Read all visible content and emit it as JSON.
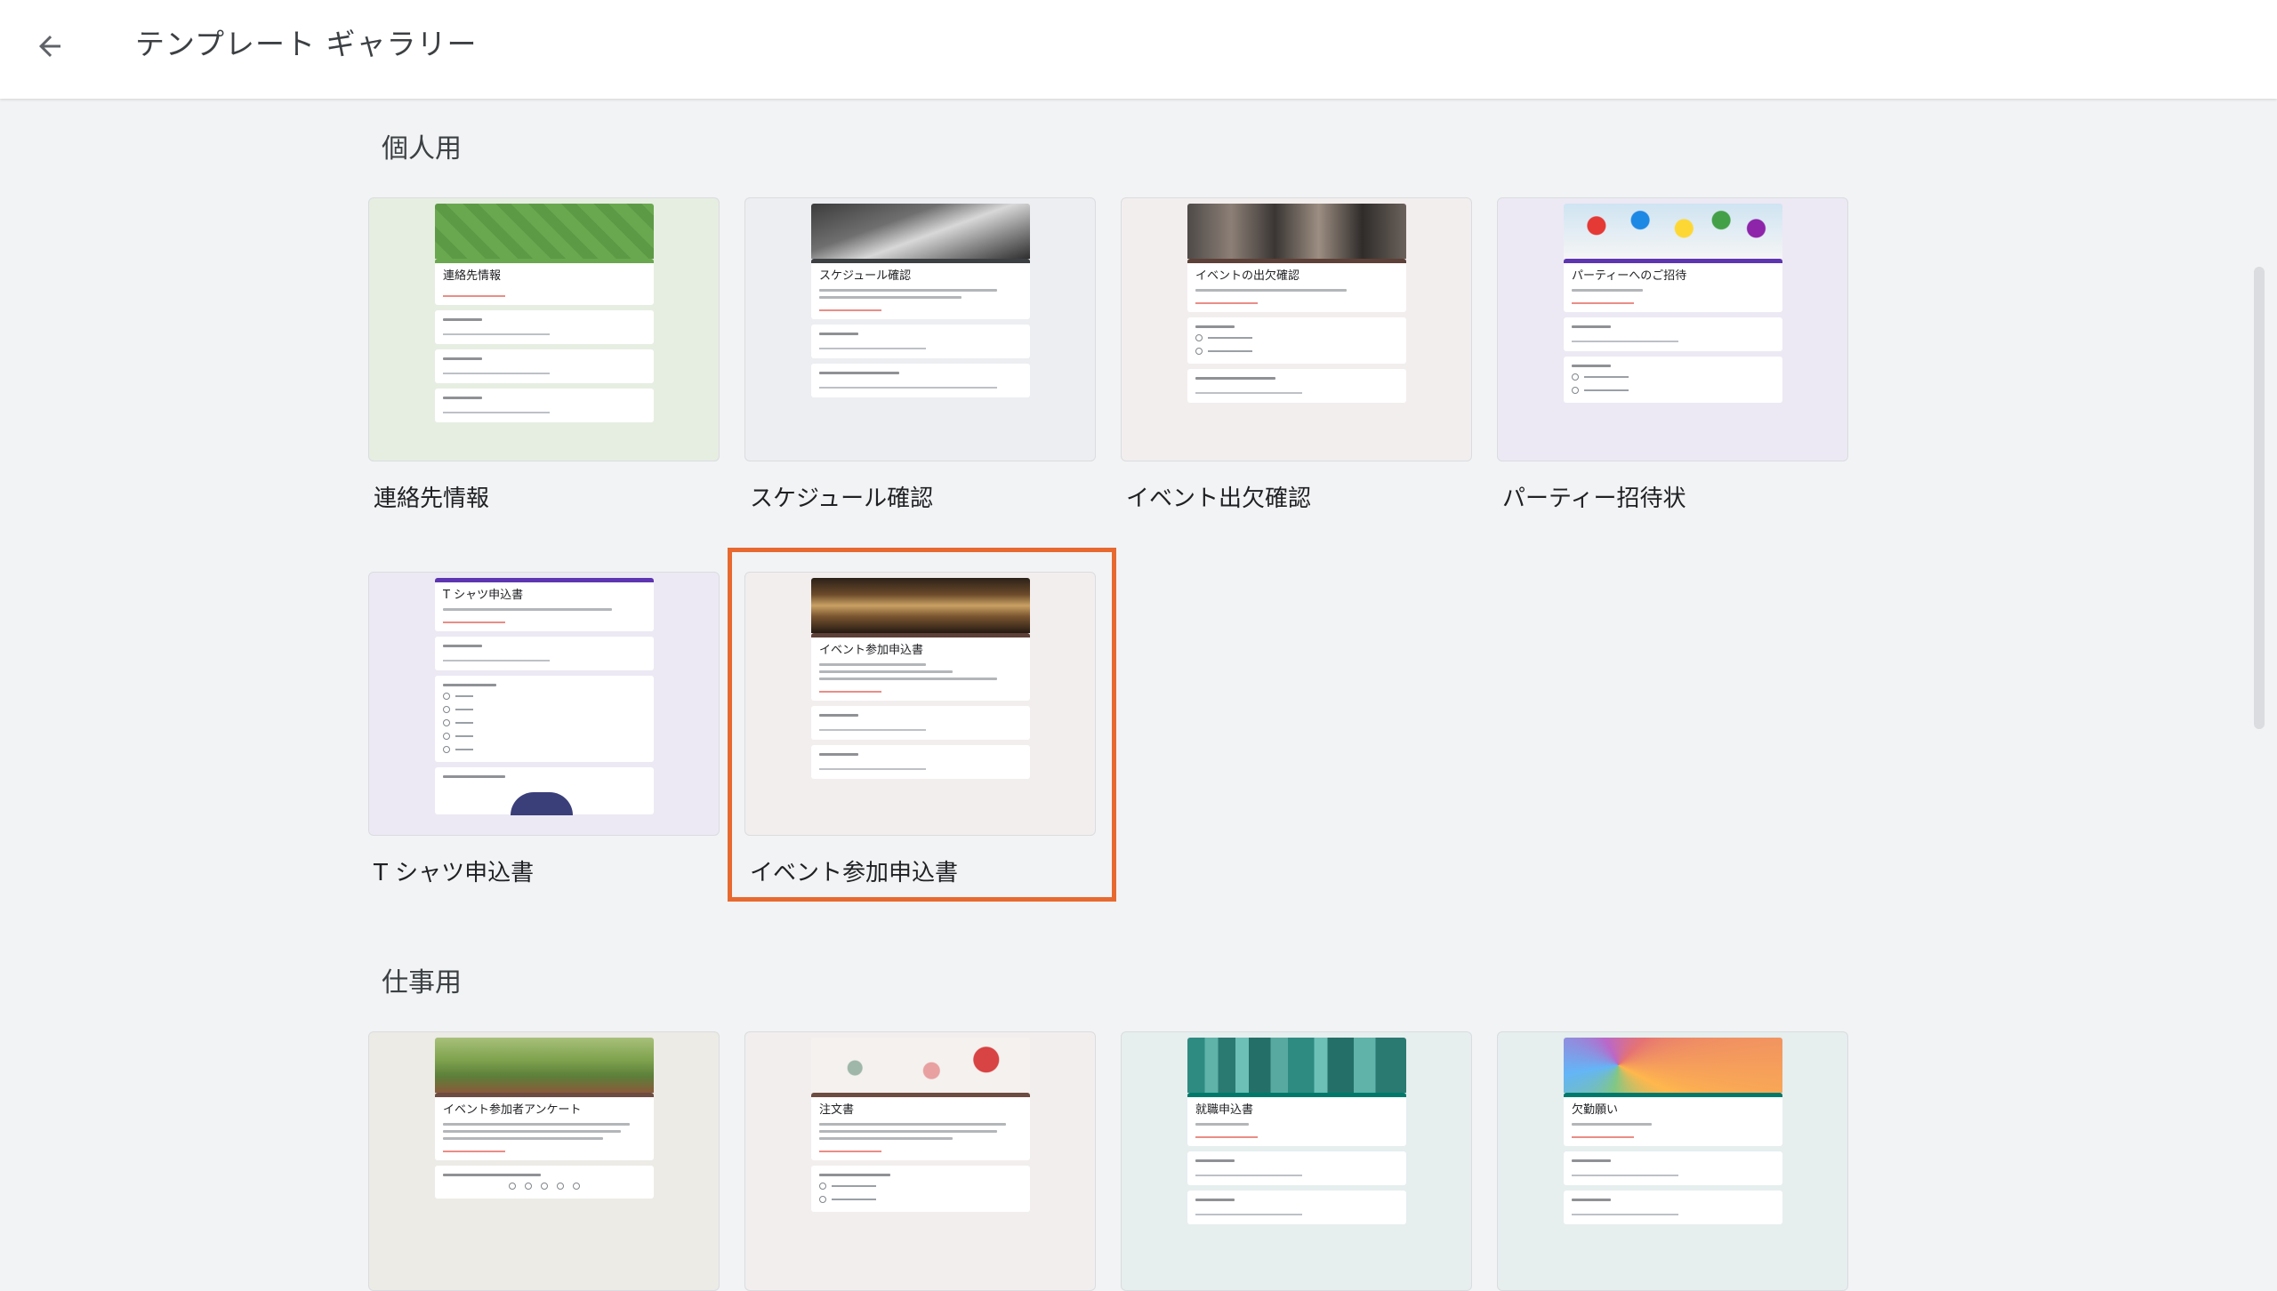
{
  "header": {
    "title": "テンプレート ギャラリー",
    "back_icon": "arrow-back-icon"
  },
  "sections": [
    {
      "title": "個人用",
      "templates": [
        {
          "label": "連絡先情報",
          "form_title": "連絡先情報",
          "theme": "#6aa84f",
          "bg": "#e6eee2",
          "header": "green-pattern"
        },
        {
          "label": "スケジュール確認",
          "form_title": "スケジュール確認",
          "theme": "#5f6368",
          "bg": "#eceef1",
          "header": "book-photo"
        },
        {
          "label": "イベント出欠確認",
          "form_title": "イベントの出欠確認",
          "theme": "#5d4037",
          "bg": "#f3eeee",
          "header": "party-photo"
        },
        {
          "label": "パーティー招待状",
          "form_title": "パーティーへのご招待",
          "theme": "#5e35b1",
          "bg": "#ece9f4",
          "header": "balloons-photo"
        },
        {
          "label": "T シャツ申込書",
          "form_title": "T シャツ申込書",
          "theme": "#5e35b1",
          "bg": "#ece9f4",
          "header": "none"
        },
        {
          "label": "イベント参加申込書",
          "form_title": "イベント参加申込書",
          "theme": "#5d4037",
          "bg": "#f3eeee",
          "header": "theater-photo",
          "selected": true
        }
      ]
    },
    {
      "title": "仕事用",
      "templates": [
        {
          "label": "",
          "form_title": "イベント参加者アンケート",
          "theme": "#6d4c41",
          "bg": "#ecebe6",
          "header": "picnic-photo"
        },
        {
          "label": "",
          "form_title": "注文書",
          "theme": "#6d4c41",
          "bg": "#f3eeee",
          "header": "flowers-pattern"
        },
        {
          "label": "",
          "form_title": "就職申込書",
          "theme": "#00796b",
          "bg": "#e6eeee",
          "header": "city-photo"
        },
        {
          "label": "",
          "form_title": "欠勤願い",
          "theme": "#00796b",
          "bg": "#e6eeee",
          "header": "mosaic-pattern"
        }
      ]
    }
  ],
  "colors": {
    "selection": "#e8692f",
    "background": "#f1f3f4"
  }
}
